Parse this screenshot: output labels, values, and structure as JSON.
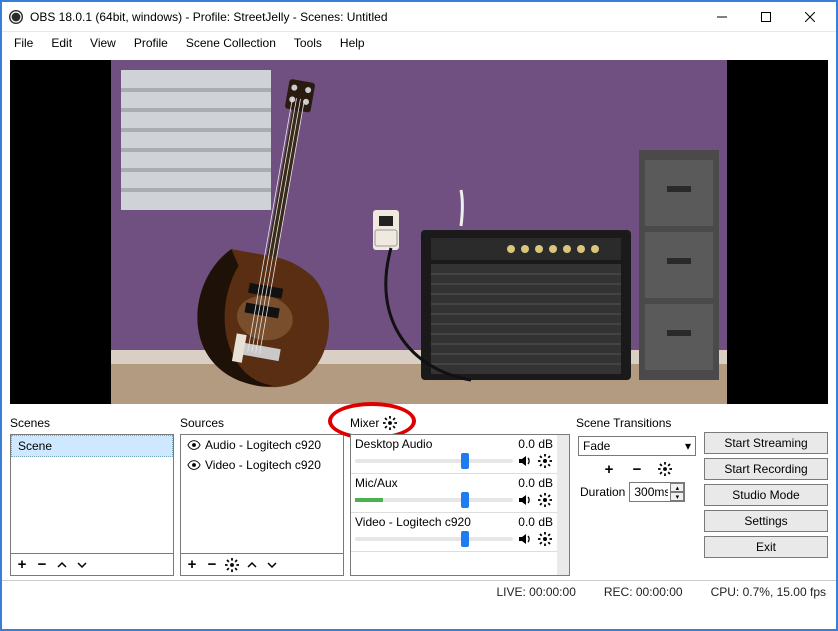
{
  "window": {
    "title": "OBS 18.0.1 (64bit, windows) - Profile: StreetJelly - Scenes: Untitled"
  },
  "menu": {
    "items": [
      "File",
      "Edit",
      "View",
      "Profile",
      "Scene Collection",
      "Tools",
      "Help"
    ]
  },
  "panels": {
    "scenes_label": "Scenes",
    "sources_label": "Sources",
    "mixer_label": "Mixer",
    "transitions_label": "Scene Transitions"
  },
  "scenes": {
    "items": [
      "Scene"
    ]
  },
  "sources": {
    "items": [
      "Audio - Logitech c920",
      "Video - Logitech c920"
    ]
  },
  "mixer": {
    "rows": [
      {
        "name": "Desktop Audio",
        "db": "0.0 dB"
      },
      {
        "name": "Mic/Aux",
        "db": "0.0 dB"
      },
      {
        "name": "Video - Logitech c920",
        "db": "0.0 dB"
      }
    ]
  },
  "transitions": {
    "selected": "Fade",
    "duration_label": "Duration",
    "duration_value": "300ms"
  },
  "actions": {
    "start_streaming": "Start Streaming",
    "start_recording": "Start Recording",
    "studio_mode": "Studio Mode",
    "settings": "Settings",
    "exit": "Exit"
  },
  "status": {
    "live": "LIVE: 00:00:00",
    "rec": "REC: 00:00:00",
    "cpu": "CPU: 0.7%, 15.00 fps"
  }
}
